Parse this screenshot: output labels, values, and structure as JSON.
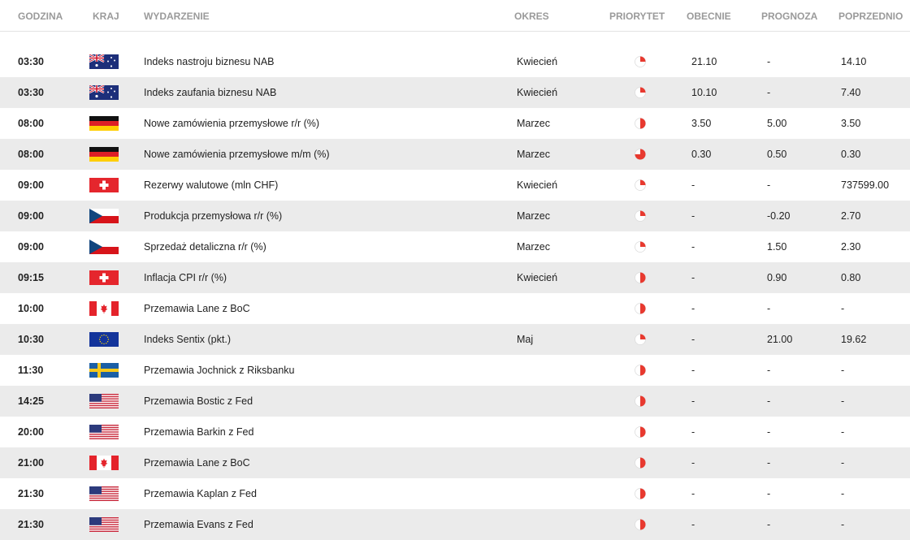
{
  "header": {
    "time": "GODZINA",
    "country": "KRAJ",
    "event": "WYDARZENIE",
    "period": "OKRES",
    "priority": "PRIORYTET",
    "current": "OBECNIE",
    "forecast": "PROGNOZA",
    "previous": "POPRZEDNIO"
  },
  "colors": {
    "priority_red": "#e8392f",
    "row_alt_bg": "#ebebeb",
    "header_text": "#9a9a9a"
  },
  "rows": [
    {
      "time": "03:30",
      "flag": "au-flag-icon",
      "event": "Indeks nastroju biznesu NAB",
      "period": "Kwiecień",
      "priority": "low",
      "current": "21.10",
      "forecast": "-",
      "previous": "14.10"
    },
    {
      "time": "03:30",
      "flag": "au-flag-icon",
      "event": "Indeks zaufania biznesu NAB",
      "period": "Kwiecień",
      "priority": "low",
      "current": "10.10",
      "forecast": "-",
      "previous": "7.40"
    },
    {
      "time": "08:00",
      "flag": "de-flag-icon",
      "event": "Nowe zamówienia przemysłowe r/r (%)",
      "period": "Marzec",
      "priority": "medium",
      "current": "3.50",
      "forecast": "5.00",
      "previous": "3.50"
    },
    {
      "time": "08:00",
      "flag": "de-flag-icon",
      "event": "Nowe zamówienia przemysłowe m/m (%)",
      "period": "Marzec",
      "priority": "high",
      "current": "0.30",
      "forecast": "0.50",
      "previous": "0.30"
    },
    {
      "time": "09:00",
      "flag": "ch-flag-icon",
      "event": "Rezerwy walutowe (mln CHF)",
      "period": "Kwiecień",
      "priority": "low",
      "current": "-",
      "forecast": "-",
      "previous": "737599.00"
    },
    {
      "time": "09:00",
      "flag": "cz-flag-icon",
      "event": "Produkcja przemysłowa r/r (%)",
      "period": "Marzec",
      "priority": "low",
      "current": "-",
      "forecast": "-0.20",
      "previous": "2.70"
    },
    {
      "time": "09:00",
      "flag": "cz-flag-icon",
      "event": "Sprzedaż detaliczna r/r (%)",
      "period": "Marzec",
      "priority": "low",
      "current": "-",
      "forecast": "1.50",
      "previous": "2.30"
    },
    {
      "time": "09:15",
      "flag": "ch-flag-icon",
      "event": "Inflacja CPI r/r (%)",
      "period": "Kwiecień",
      "priority": "medium",
      "current": "-",
      "forecast": "0.90",
      "previous": "0.80"
    },
    {
      "time": "10:00",
      "flag": "ca-flag-icon",
      "event": "Przemawia Lane z BoC",
      "period": "",
      "priority": "medium",
      "current": "-",
      "forecast": "-",
      "previous": "-"
    },
    {
      "time": "10:30",
      "flag": "eu-flag-icon",
      "event": "Indeks Sentix (pkt.)",
      "period": "Maj",
      "priority": "low",
      "current": "-",
      "forecast": "21.00",
      "previous": "19.62"
    },
    {
      "time": "11:30",
      "flag": "se-flag-icon",
      "event": "Przemawia Jochnick z Riksbanku",
      "period": "",
      "priority": "medium",
      "current": "-",
      "forecast": "-",
      "previous": "-"
    },
    {
      "time": "14:25",
      "flag": "us-flag-icon",
      "event": "Przemawia Bostic z Fed",
      "period": "",
      "priority": "medium",
      "current": "-",
      "forecast": "-",
      "previous": "-"
    },
    {
      "time": "20:00",
      "flag": "us-flag-icon",
      "event": "Przemawia Barkin z Fed",
      "period": "",
      "priority": "medium",
      "current": "-",
      "forecast": "-",
      "previous": "-"
    },
    {
      "time": "21:00",
      "flag": "ca-flag-icon",
      "event": "Przemawia Lane z BoC",
      "period": "",
      "priority": "medium",
      "current": "-",
      "forecast": "-",
      "previous": "-"
    },
    {
      "time": "21:30",
      "flag": "us-flag-icon",
      "event": "Przemawia Kaplan z Fed",
      "period": "",
      "priority": "medium",
      "current": "-",
      "forecast": "-",
      "previous": "-"
    },
    {
      "time": "21:30",
      "flag": "us-flag-icon",
      "event": "Przemawia Evans z Fed",
      "period": "",
      "priority": "medium",
      "current": "-",
      "forecast": "-",
      "previous": "-"
    }
  ]
}
